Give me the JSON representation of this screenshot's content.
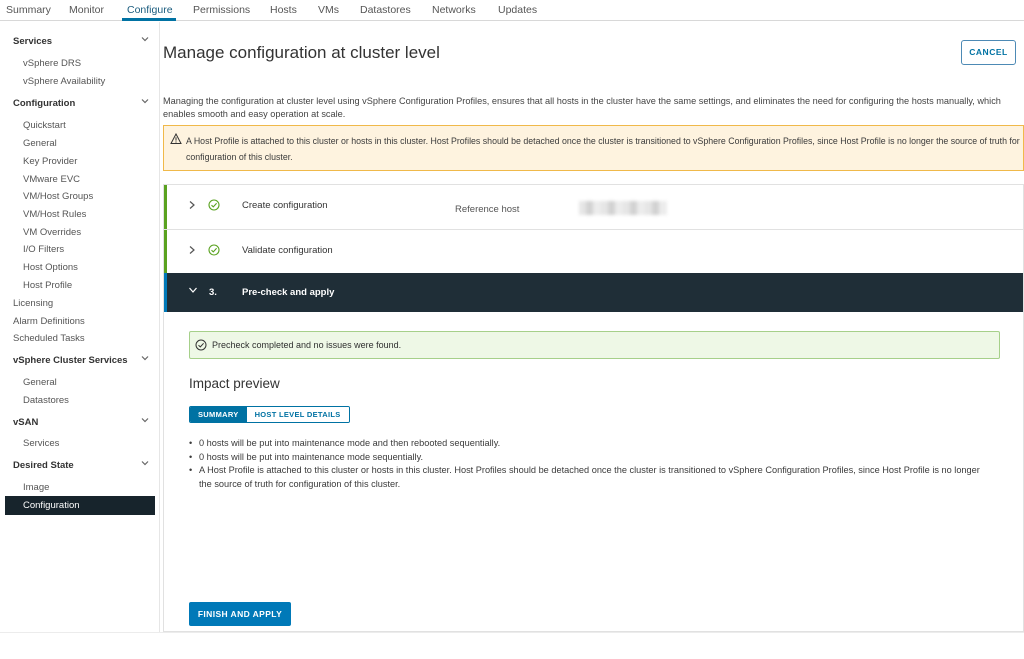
{
  "tabs": [
    "Summary",
    "Monitor",
    "Configure",
    "Permissions",
    "Hosts",
    "VMs",
    "Datastores",
    "Networks",
    "Updates"
  ],
  "active_tab": "Configure",
  "sidebar": {
    "services": {
      "label": "Services",
      "items": [
        "vSphere DRS",
        "vSphere Availability"
      ]
    },
    "configuration": {
      "label": "Configuration",
      "items": [
        "Quickstart",
        "General",
        "Key Provider",
        "VMware EVC",
        "VM/Host Groups",
        "VM/Host Rules",
        "VM Overrides",
        "I/O Filters",
        "Host Options",
        "Host Profile"
      ]
    },
    "plain": [
      "Licensing",
      "Alarm Definitions",
      "Scheduled Tasks"
    ],
    "cluster_services": {
      "label": "vSphere Cluster Services",
      "items": [
        "General",
        "Datastores"
      ]
    },
    "vsan": {
      "label": "vSAN",
      "items": [
        "Services"
      ]
    },
    "desired_state": {
      "label": "Desired State",
      "items": [
        "Image",
        "Configuration"
      ]
    },
    "selected": "Configuration"
  },
  "page": {
    "title": "Manage configuration at cluster level",
    "cancel": "CANCEL",
    "description": "Managing the configuration at cluster level using vSphere Configuration Profiles, ensures that all hosts in the cluster have the same settings, and eliminates the need for configuring the hosts manually, which enables smooth and easy operation at scale.",
    "warning": "A Host Profile is attached to this cluster or hosts in this cluster. Host Profiles should be detached once the cluster is transitioned to vSphere Configuration Profiles, since Host Profile is no longer the source of truth for configuration of this cluster."
  },
  "steps": {
    "step1": {
      "title": "Create configuration",
      "ref_label": "Reference host"
    },
    "step2": {
      "title": "Validate configuration"
    },
    "step3": {
      "num": "3.",
      "title": "Pre-check and apply"
    }
  },
  "precheck": {
    "message": "Precheck completed and no issues were found.",
    "impact_title": "Impact preview",
    "seg_summary": "SUMMARY",
    "seg_host": "HOST LEVEL DETAILS",
    "bullets": [
      "0 hosts will be put into maintenance mode and then rebooted sequentially.",
      "0 hosts will be put into maintenance mode sequentially.",
      "A Host Profile is attached to this cluster or hosts in this cluster. Host Profiles should be detached once the cluster is transitioned to vSphere Configuration Profiles, since Host Profile is no longer the source of truth for configuration of this cluster."
    ],
    "finish": "FINISH AND APPLY"
  },
  "colors": {
    "accent": "#0072a3",
    "success": "#5aa220",
    "warning_bg": "#fef3df",
    "dark_header": "#1f2e37",
    "sidebar_selected": "#17242c"
  },
  "icons": {
    "chevron": "chevron-down-icon",
    "check": "check-circle-icon",
    "warning": "warning-triangle-icon",
    "expand": "chevron-right-icon"
  }
}
